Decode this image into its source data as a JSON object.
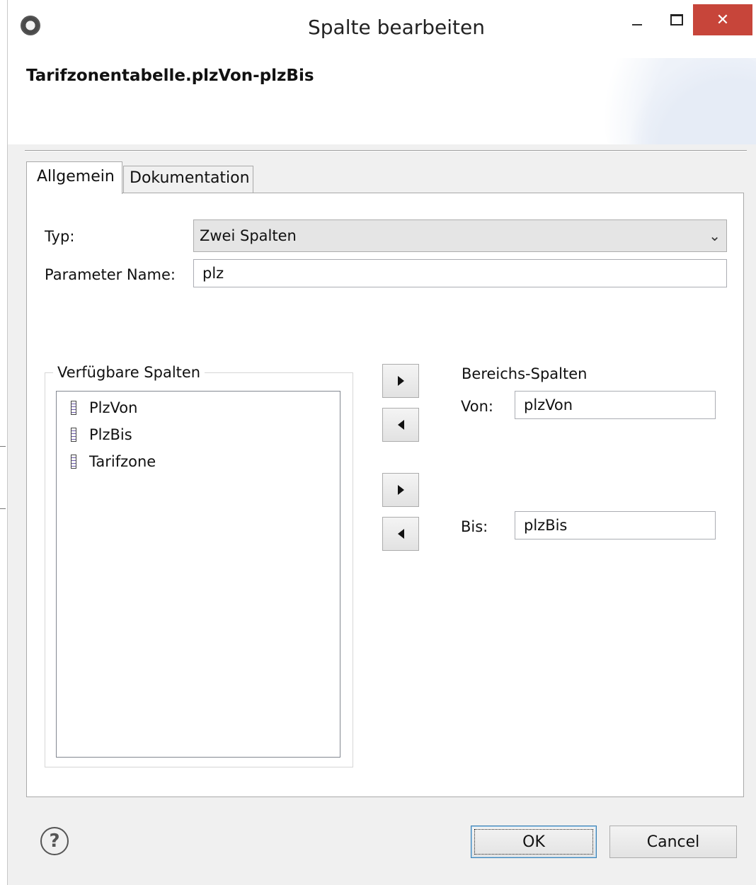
{
  "window": {
    "title": "Spalte bearbeiten",
    "close_glyph": "✕",
    "app_icon": "gear-icon"
  },
  "header": {
    "title": "Tarifzonentabelle.plzVon-plzBis"
  },
  "tabs": [
    {
      "label": "Allgemein",
      "selected": true
    },
    {
      "label": "Dokumentation",
      "selected": false
    }
  ],
  "form": {
    "typ_label": "Typ:",
    "typ_value": "Zwei Spalten",
    "param_label": "Parameter Name:",
    "param_value": "plz"
  },
  "available": {
    "legend": "Verfügbare Spalten",
    "items": [
      "PlzVon",
      "PlzBis",
      "Tarifzone"
    ]
  },
  "range": {
    "heading": "Bereichs-Spalten",
    "von_label": "Von:",
    "von_value": "plzVon",
    "bis_label": "Bis:",
    "bis_value": "plzBis"
  },
  "buttons": {
    "help_glyph": "?",
    "ok_label": "OK",
    "cancel_label": "Cancel"
  }
}
